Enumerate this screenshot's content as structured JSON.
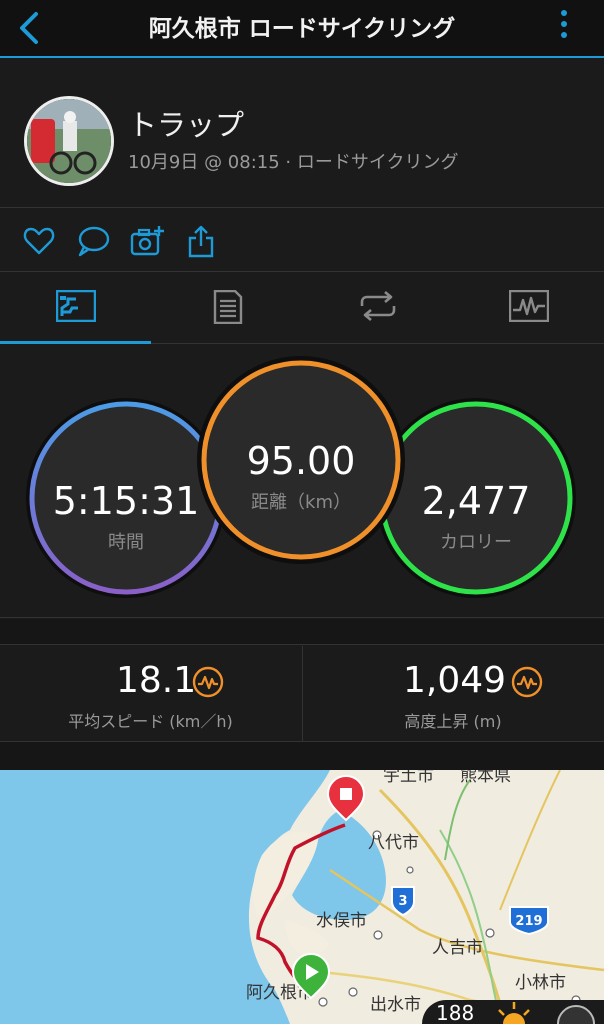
{
  "header": {
    "title": "阿久根市 ロードサイクリング"
  },
  "activity": {
    "name": "トラップ",
    "meta": "10月9日 @ 08:15 · ロードサイクリング"
  },
  "tabs": [
    "summary",
    "details",
    "laps",
    "graphs"
  ],
  "stats": {
    "time": {
      "value": "5:15:31",
      "label": "時間"
    },
    "distance": {
      "value": "95.00",
      "label": "距離（km）"
    },
    "calories": {
      "value": "2,477",
      "label": "カロリー"
    }
  },
  "metrics": {
    "avg_speed": {
      "value": "18.1",
      "label": "平均スピード (km／h)"
    },
    "elevation_gain": {
      "value": "1,049",
      "label": "高度上昇 (m)"
    }
  },
  "map": {
    "labels": [
      "宇土市",
      "熊本県",
      "八代市",
      "水俣市",
      "人吉市",
      "小林市",
      "阿久根市",
      "出水市"
    ],
    "route_badges": [
      "3",
      "219"
    ]
  },
  "weather": {
    "temp_partial": "188"
  },
  "colors": {
    "accent": "#1e9bd7",
    "time_ring": "#4f8fe0",
    "distance_ring": "#f0902a",
    "calorie_ring": "#2ee34a",
    "route": "#c1122a"
  }
}
